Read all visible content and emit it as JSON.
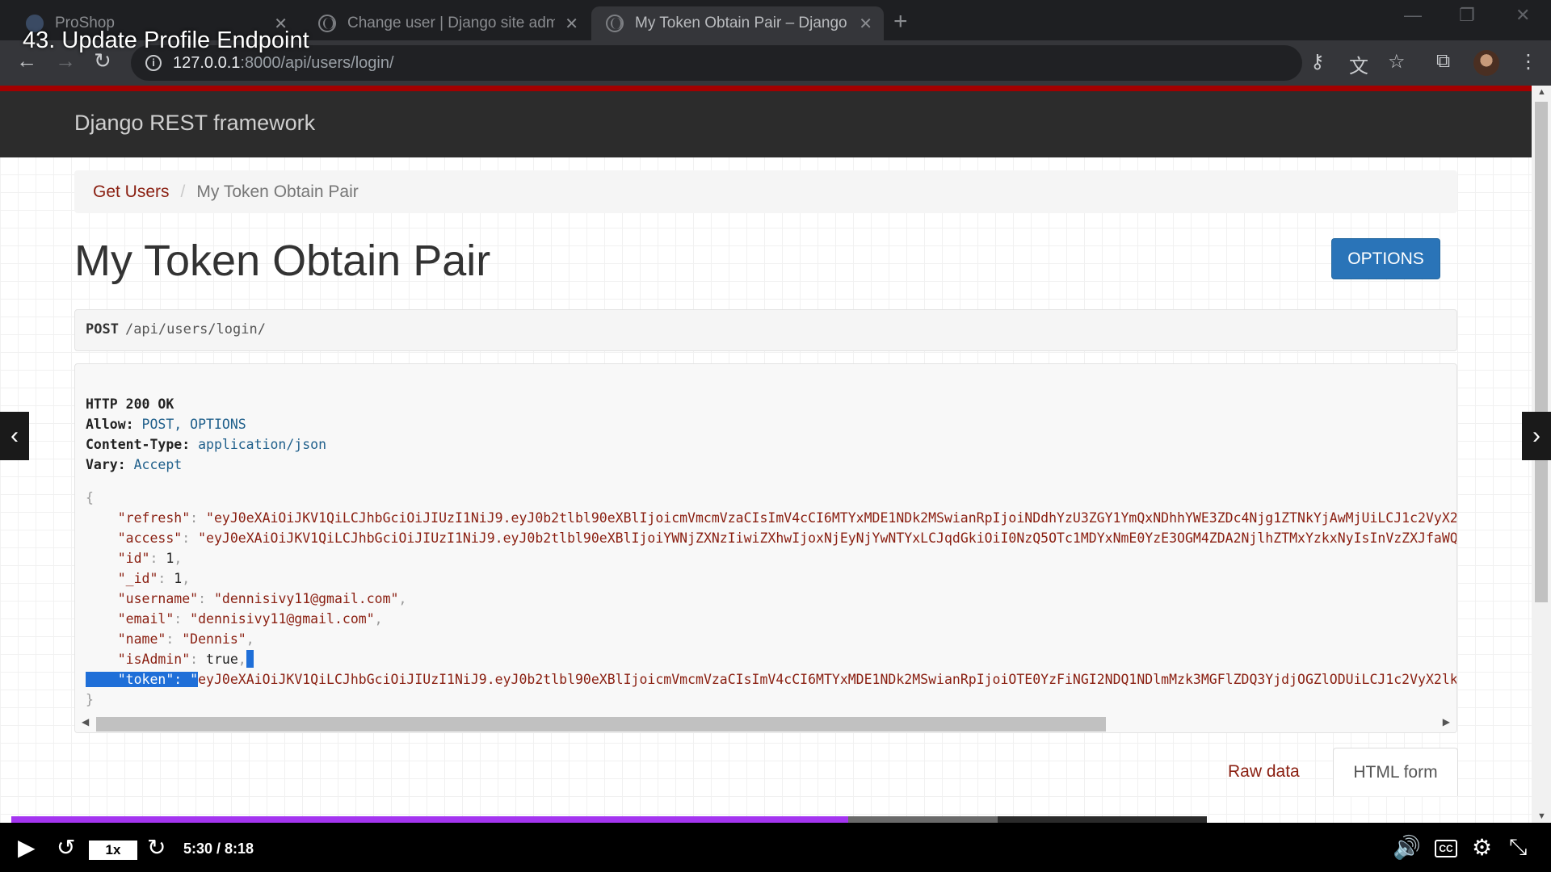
{
  "video": {
    "title": "43. Update Profile Endpoint"
  },
  "browser": {
    "tabs": [
      {
        "label": "ProShop",
        "active": false
      },
      {
        "label": "Change user | Django site admin",
        "active": false
      },
      {
        "label": "My Token Obtain Pair – Django R",
        "active": true
      }
    ],
    "url_host": "127.0.0.1",
    "url_rest": ":8000/api/users/login/"
  },
  "drf": {
    "brand": "Django REST framework",
    "breadcrumb": {
      "parent": "Get Users",
      "current": "My Token Obtain Pair"
    },
    "title": "My Token Obtain Pair",
    "options_label": "OPTIONS",
    "request": {
      "method": "POST",
      "path": "/api/users/login/"
    },
    "response": {
      "status": "HTTP 200 OK",
      "headers": [
        {
          "key": "Allow:",
          "value": "POST, OPTIONS"
        },
        {
          "key": "Content-Type:",
          "value": "application/json"
        },
        {
          "key": "Vary:",
          "value": "Accept"
        }
      ],
      "open_brace": "{",
      "close_brace": "}",
      "refresh_key": "\"refresh\"",
      "refresh_val": "\"eyJ0eXAiOiJKV1QiLCJhbGciOiJIUzI1NiJ9.eyJ0b2tlbl90eXBlIjoicmVmcmVzaCIsImV4cCI6MTYxMDE1NDk2MSwianRpIjoiNDdhYzU3ZGY1YmQxNDhhYWE3ZDc4Njg1ZTNkYjAwMjUiLCJ1c2VyX2",
      "access_key": "\"access\"",
      "access_val": "\"eyJ0eXAiOiJKV1QiLCJhbGciOiJIUzI1NiJ9.eyJ0b2tlbl90eXBlIjoiYWNjZXNzIiwiZXhwIjoxNjEyNjYwNTYxLCJqdGkiOiI0NzQ5OTc1MDYxNmE0YzE3OGM4ZDA2NjlhZTMxYzkxNyIsInVzZXJfaWQ",
      "id_key": "\"id\"",
      "id_val": "1",
      "_id_key": "\"_id\"",
      "_id_val": "1",
      "username_key": "\"username\"",
      "username_val": "\"dennisivy11@gmail.com\"",
      "email_key": "\"email\"",
      "email_val": "\"dennisivy11@gmail.com\"",
      "name_key": "\"name\"",
      "name_val": "\"Dennis\"",
      "isAdmin_key": "\"isAdmin\"",
      "isAdmin_val": "true",
      "token_key": "\"token\"",
      "token_val": "eyJ0eXAiOiJKV1QiLCJhbGciOiJIUzI1NiJ9.eyJ0b2tlbl90eXBlIjoicmVmcmVzaCIsImV4cCI6MTYxMDE1NDk2MSwianRpIjoiOTE0YzFiNGI2NDQ1NDlmMzk3MGFlZDQ3YjdjOGZlODUiLCJ1c2VyX2lk"
    },
    "raw_data_label": "Raw data",
    "html_form_label": "HTML form"
  },
  "player": {
    "speed": "1x",
    "time": "5:30 / 8:18",
    "progress_fraction": 0.7,
    "buffered_fraction": 0.825,
    "cc_label": "CC"
  },
  "colors": {
    "progress": "#a435f0",
    "drf_red": "#a30000",
    "options_blue": "#2a74b8"
  }
}
